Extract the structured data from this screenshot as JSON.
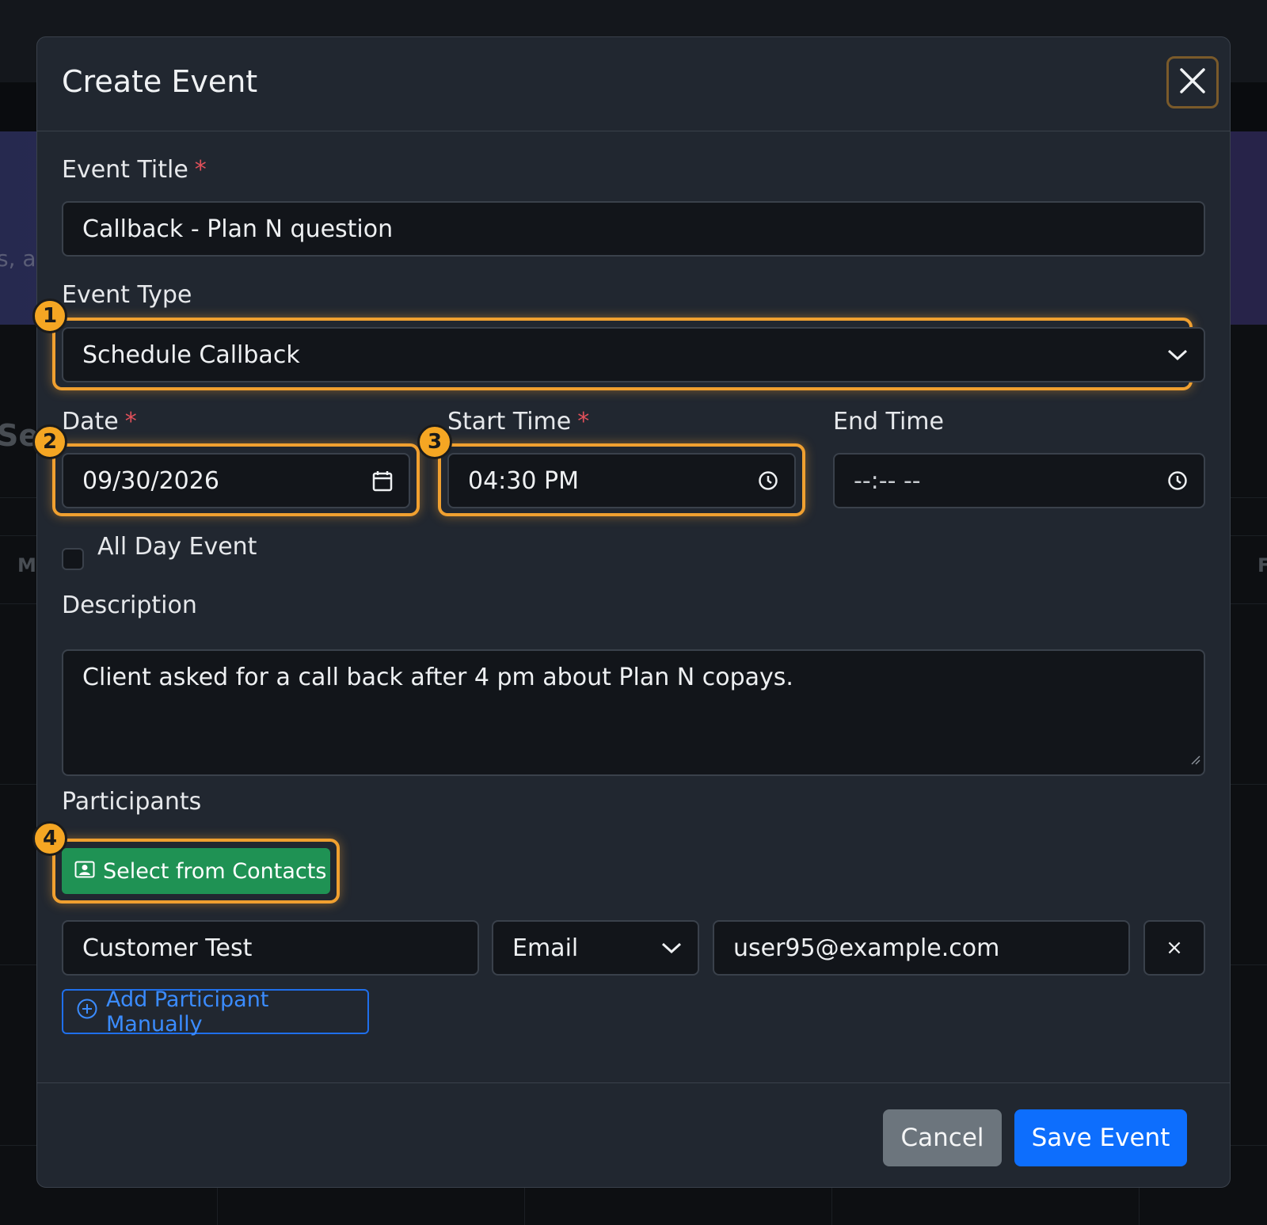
{
  "background": {
    "hero_fragment": "s, a",
    "section_fragment": "Se",
    "day_left": "M",
    "day_right": "F"
  },
  "modal": {
    "title": "Create Event",
    "close_icon": "close-icon"
  },
  "form": {
    "event_title": {
      "label": "Event Title",
      "required": "*",
      "value": "Callback - Plan N question"
    },
    "event_type": {
      "label": "Event Type",
      "value": "Schedule Callback",
      "badge": "1"
    },
    "date": {
      "label": "Date",
      "required": "*",
      "value": "09/30/2026",
      "badge": "2"
    },
    "start_time": {
      "label": "Start Time",
      "required": "*",
      "value": "04:30 PM",
      "badge": "3"
    },
    "end_time": {
      "label": "End Time",
      "placeholder": "--:-- --"
    },
    "all_day": {
      "label": "All Day Event",
      "checked": false
    },
    "description": {
      "label": "Description",
      "value": "Client asked for a call back after 4 pm about Plan N copays."
    }
  },
  "participants": {
    "label": "Participants",
    "select_contacts_label": "Select from Contacts",
    "badge": "4",
    "rows": [
      {
        "name": "Customer Test",
        "method": "Email",
        "contact": "user95@example.com",
        "remove": "×"
      }
    ],
    "add_manual_label": "Add Participant Manually"
  },
  "footer": {
    "cancel_label": "Cancel",
    "save_label": "Save Event"
  },
  "colors": {
    "highlight": "#f0a030",
    "badge": "#f5a623",
    "primary": "#0d6efd",
    "success": "#1f9254",
    "secondary": "#6c757d",
    "required": "#e0505a"
  }
}
